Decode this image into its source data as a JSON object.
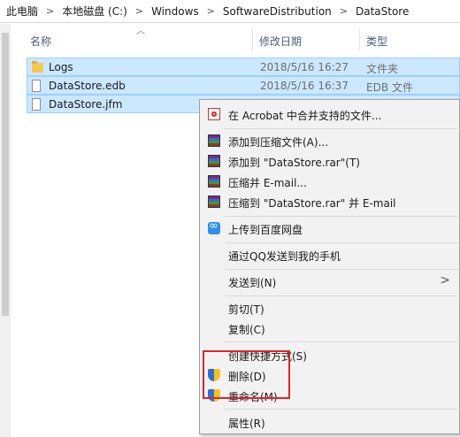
{
  "breadcrumb": [
    "此电脑",
    "本地磁盘 (C:)",
    "Windows",
    "SoftwareDistribution",
    "DataStore"
  ],
  "columns": {
    "name": "名称",
    "date": "修改日期",
    "type": "类型"
  },
  "files": [
    {
      "name": "Logs",
      "date": "2018/5/16 16:27",
      "type": "文件夹",
      "icon": "folder-icon"
    },
    {
      "name": "DataStore.edb",
      "date": "2018/5/16 16:37",
      "type": "EDB 文件",
      "icon": "file-icon"
    },
    {
      "name": "DataStore.jfm",
      "date": "",
      "type": "",
      "icon": "file-icon"
    }
  ],
  "menu": {
    "acrobat": "在 Acrobat 中合并支持的文件...",
    "add_archive": "添加到压缩文件(A)...",
    "add_rar": "添加到 \"DataStore.rar\"(T)",
    "compress_email": "压缩并 E-mail...",
    "compress_rar_email": "压缩到 \"DataStore.rar\" 并 E-mail",
    "baidu": "上传到百度网盘",
    "qq": "通过QQ发送到我的手机",
    "send_to": "发送到(N)",
    "cut": "剪切(T)",
    "copy": "复制(C)",
    "shortcut": "创建快捷方式(S)",
    "delete": "删除(D)",
    "rename": "重命名(M)",
    "properties": "属性(R)"
  },
  "colors": {
    "selection": "#cce8ff",
    "highlight_box": "#e0242a"
  }
}
